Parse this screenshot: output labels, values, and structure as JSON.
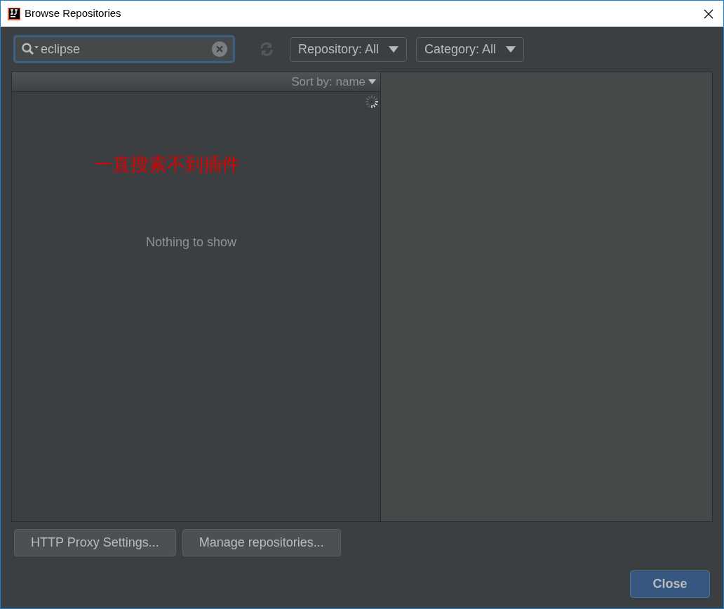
{
  "window": {
    "title": "Browse Repositories"
  },
  "search": {
    "value": "eclipse"
  },
  "filters": [
    {
      "label": "Repository: All"
    },
    {
      "label": "Category: All"
    }
  ],
  "list": {
    "sort_label": "Sort by: name",
    "loading": true,
    "empty_text": "Nothing to show",
    "annotation": "一直搜索不到插件"
  },
  "buttons": [
    {
      "label": "HTTP Proxy Settings..."
    },
    {
      "label": "Manage repositories..."
    }
  ],
  "close_button": {
    "label": "Close"
  }
}
